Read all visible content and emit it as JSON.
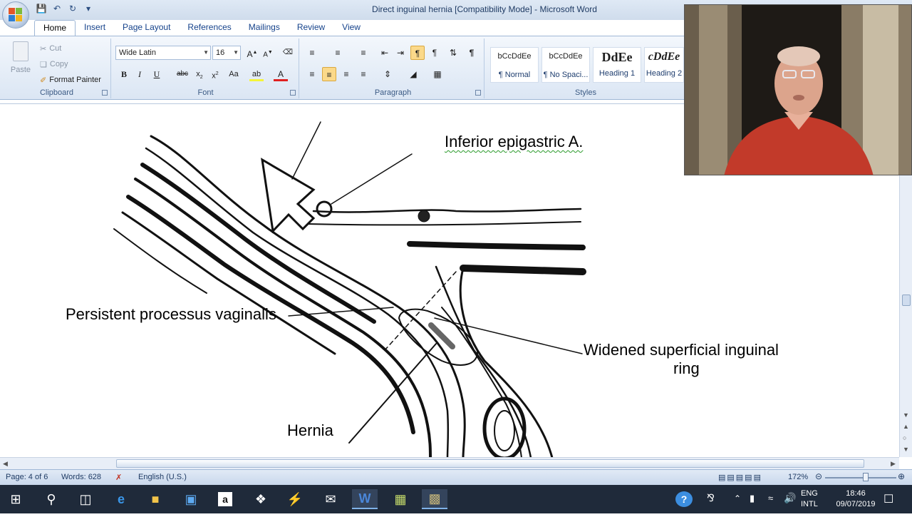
{
  "window": {
    "title": "Direct inguinal hernia [Compatibility Mode] - Microsoft Word"
  },
  "tabs": [
    "Home",
    "Insert",
    "Page Layout",
    "References",
    "Mailings",
    "Review",
    "View"
  ],
  "clipboard": {
    "paste": "Paste",
    "cut": "Cut",
    "copy": "Copy",
    "format_painter": "Format Painter",
    "group_label": "Clipboard"
  },
  "font": {
    "name": "Wide Latin",
    "size": "16",
    "group_label": "Font"
  },
  "paragraph": {
    "group_label": "Paragraph"
  },
  "styles": {
    "group_label": "Styles",
    "items": [
      {
        "sample": "bCcDdEe",
        "name": "¶ Normal"
      },
      {
        "sample": "bCcDdEe",
        "name": "¶ No Spaci..."
      },
      {
        "sample": "DdEe",
        "name": "Heading 1"
      },
      {
        "sample": "cDdEe",
        "name": "Heading 2"
      }
    ]
  },
  "document": {
    "labels": {
      "inferior_epigastric": "Inferior epigastric A.",
      "processus_vaginalis": "Persistent processus vaginalis",
      "superficial_ring_line1": "Widened superficial inguinal",
      "superficial_ring_line2": "ring",
      "hernia": "Hernia"
    }
  },
  "status": {
    "page": "Page: 4 of 6",
    "words": "Words: 628",
    "language": "English (U.S.)",
    "zoom": "172%",
    "zoom_fraction": 0.58
  },
  "taskbar": {
    "apps": [
      "start",
      "search",
      "task-view",
      "edge",
      "file-explorer",
      "store",
      "amazon",
      "dropbox",
      "app-blue",
      "mail",
      "word",
      "excel-green",
      "app-active"
    ],
    "lang_top": "ENG",
    "lang_bottom": "INTL",
    "time": "18:46",
    "date": "09/07/2019"
  },
  "colors": {
    "accent": "#15428b",
    "ribbon": "#dbe6f4",
    "taskbar": "#1f2a3a"
  }
}
